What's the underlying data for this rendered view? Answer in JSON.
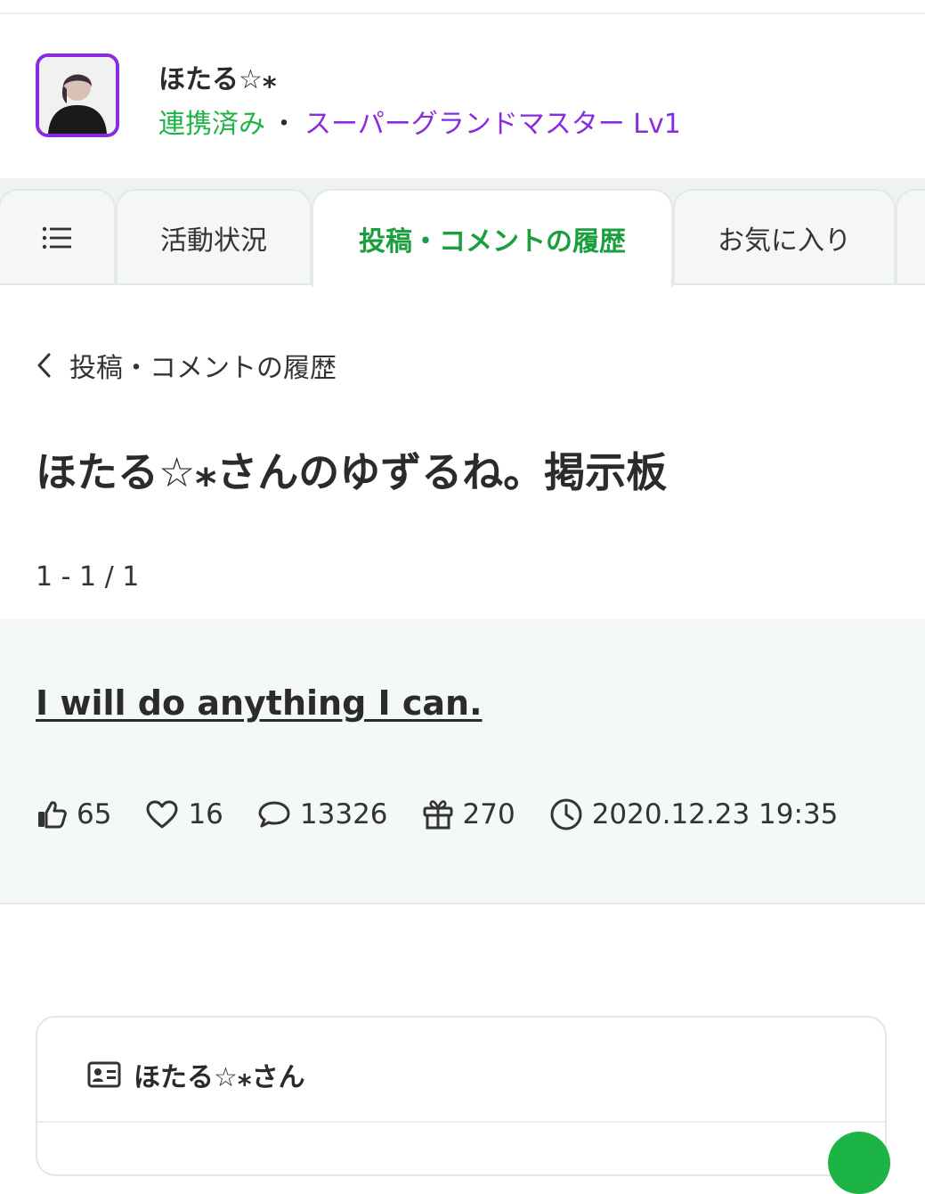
{
  "profile": {
    "name": "ほたる☆⁎",
    "linked_label": "連携済み",
    "separator": "・",
    "rank": "スーパーグランドマスター Lv1",
    "colors": {
      "linked": "#1db446",
      "rank": "#8a2be2",
      "avatar_border": "#8a2be2"
    }
  },
  "tabs": {
    "menu_icon": "list-icon",
    "items": [
      {
        "label": "活動状況",
        "active": false
      },
      {
        "label": "投稿・コメントの履歴",
        "active": true
      },
      {
        "label": "お気に入り",
        "active": false
      }
    ],
    "active_color": "#1a9e3f"
  },
  "breadcrumb": {
    "back_icon": "chevron-left-icon",
    "label": "投稿・コメントの履歴"
  },
  "page": {
    "title": "ほたる☆⁎さんのゆずるね。掲示板",
    "count": "1 - 1 / 1"
  },
  "post": {
    "title": "I will do anything I can.",
    "likes": "65",
    "hearts": "16",
    "comments": "13326",
    "gifts": "270",
    "datetime": "2020.12.23 19:35"
  },
  "profile_card": {
    "icon": "id-card-icon",
    "name": "ほたる☆⁎さん"
  }
}
